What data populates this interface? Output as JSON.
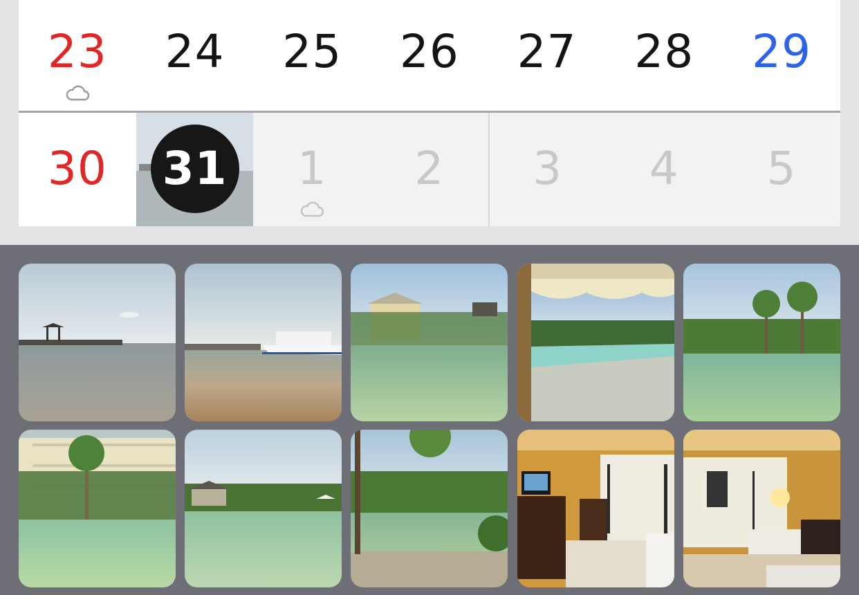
{
  "calendar": {
    "week1": [
      {
        "day": "23",
        "color": "#e02728",
        "weather_icon": "cloud-icon"
      },
      {
        "day": "24",
        "color": "#141414"
      },
      {
        "day": "25",
        "color": "#141414"
      },
      {
        "day": "26",
        "color": "#141414"
      },
      {
        "day": "27",
        "color": "#141414"
      },
      {
        "day": "28",
        "color": "#141414"
      },
      {
        "day": "29",
        "color": "#2e63e8"
      }
    ],
    "week2": [
      {
        "day": "30",
        "color": "#e02728"
      },
      {
        "day": "31",
        "selected": true,
        "has_photo": true
      },
      {
        "day": "1",
        "next_month": true,
        "weather_icon": "cloud-icon"
      },
      {
        "day": "2",
        "next_month": true
      },
      {
        "day": "3",
        "next_month": true
      },
      {
        "day": "4",
        "next_month": true
      },
      {
        "day": "5",
        "next_month": true
      }
    ]
  },
  "gallery": {
    "photos": [
      {
        "subject": "pier-sea-photo"
      },
      {
        "subject": "beach-boat-photo"
      },
      {
        "subject": "lagoon-hotel-photo"
      },
      {
        "subject": "pool-terrace-photo"
      },
      {
        "subject": "palm-lagoon-photo"
      },
      {
        "subject": "hotel-palm-lagoon-photo"
      },
      {
        "subject": "lagoon-gazebo-photo"
      },
      {
        "subject": "lagoon-tree-photo"
      },
      {
        "subject": "hotel-room-tv-photo"
      },
      {
        "subject": "hotel-room-bed-photo"
      }
    ]
  }
}
